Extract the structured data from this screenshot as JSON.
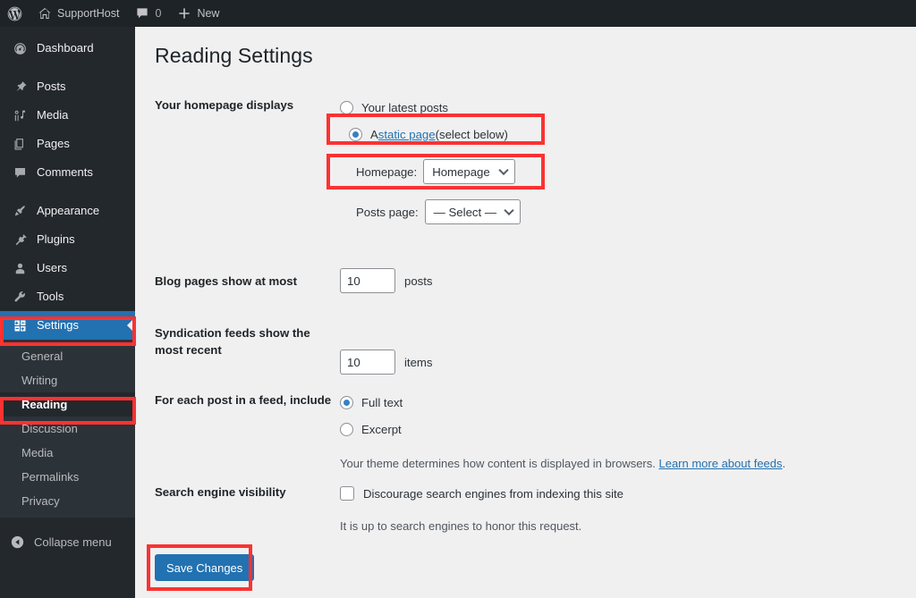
{
  "adminbar": {
    "wp_logo_icon": "wordpress-logo-icon",
    "site_icon": "home-icon",
    "site_name": "SupportHost",
    "comments_icon": "comment-bubble-icon",
    "comments_count": "0",
    "new_icon": "plus-icon",
    "new_label": "New"
  },
  "sidebar": {
    "items": [
      {
        "label": "Dashboard",
        "icon": "dashboard-gauge-icon"
      },
      {
        "label": "Posts",
        "icon": "pushpin-icon"
      },
      {
        "label": "Media",
        "icon": "media-music-icon"
      },
      {
        "label": "Pages",
        "icon": "pages-icon"
      },
      {
        "label": "Comments",
        "icon": "comment-bubble-icon"
      },
      {
        "label": "Appearance",
        "icon": "paintbrush-icon"
      },
      {
        "label": "Plugins",
        "icon": "plug-icon"
      },
      {
        "label": "Users",
        "icon": "user-icon"
      },
      {
        "label": "Tools",
        "icon": "wrench-icon"
      },
      {
        "label": "Settings",
        "icon": "settings-sliders-icon"
      }
    ],
    "submenu": [
      {
        "label": "General"
      },
      {
        "label": "Writing"
      },
      {
        "label": "Reading"
      },
      {
        "label": "Discussion"
      },
      {
        "label": "Media"
      },
      {
        "label": "Permalinks"
      },
      {
        "label": "Privacy"
      }
    ],
    "collapse": {
      "label": "Collapse menu",
      "icon": "collapse-arrow-icon"
    },
    "current_item": "Settings",
    "current_subitem": "Reading"
  },
  "page": {
    "title": "Reading Settings"
  },
  "form": {
    "homepage_displays": {
      "label": "Your homepage displays",
      "option_latest": "Your latest posts",
      "option_static_prefix": "A ",
      "option_static_link": "static page",
      "option_static_suffix": " (select below)",
      "homepage_label": "Homepage:",
      "homepage_value": "Homepage",
      "posts_page_label": "Posts page:",
      "posts_page_value": "— Select —"
    },
    "blog_pages": {
      "label": "Blog pages show at most",
      "value": "10",
      "unit": "posts"
    },
    "syndication": {
      "label": "Syndication feeds show the most recent",
      "value": "10",
      "unit": "items"
    },
    "feed_include": {
      "label": "For each post in a feed, include",
      "option_full": "Full text",
      "option_excerpt": "Excerpt",
      "description_text": "Your theme determines how content is displayed in browsers. ",
      "description_link": "Learn more about feeds",
      "description_end": "."
    },
    "search_visibility": {
      "label": "Search engine visibility",
      "checkbox_label": "Discourage search engines from indexing this site",
      "note": "It is up to search engines to honor this request."
    },
    "save_button": "Save Changes"
  },
  "colors": {
    "highlight": "#fc3232",
    "accent_blue": "#2271b1",
    "sidebar_bg": "#23282d",
    "adminbar_bg": "#1d2327",
    "content_bg": "#f0f0f1"
  }
}
